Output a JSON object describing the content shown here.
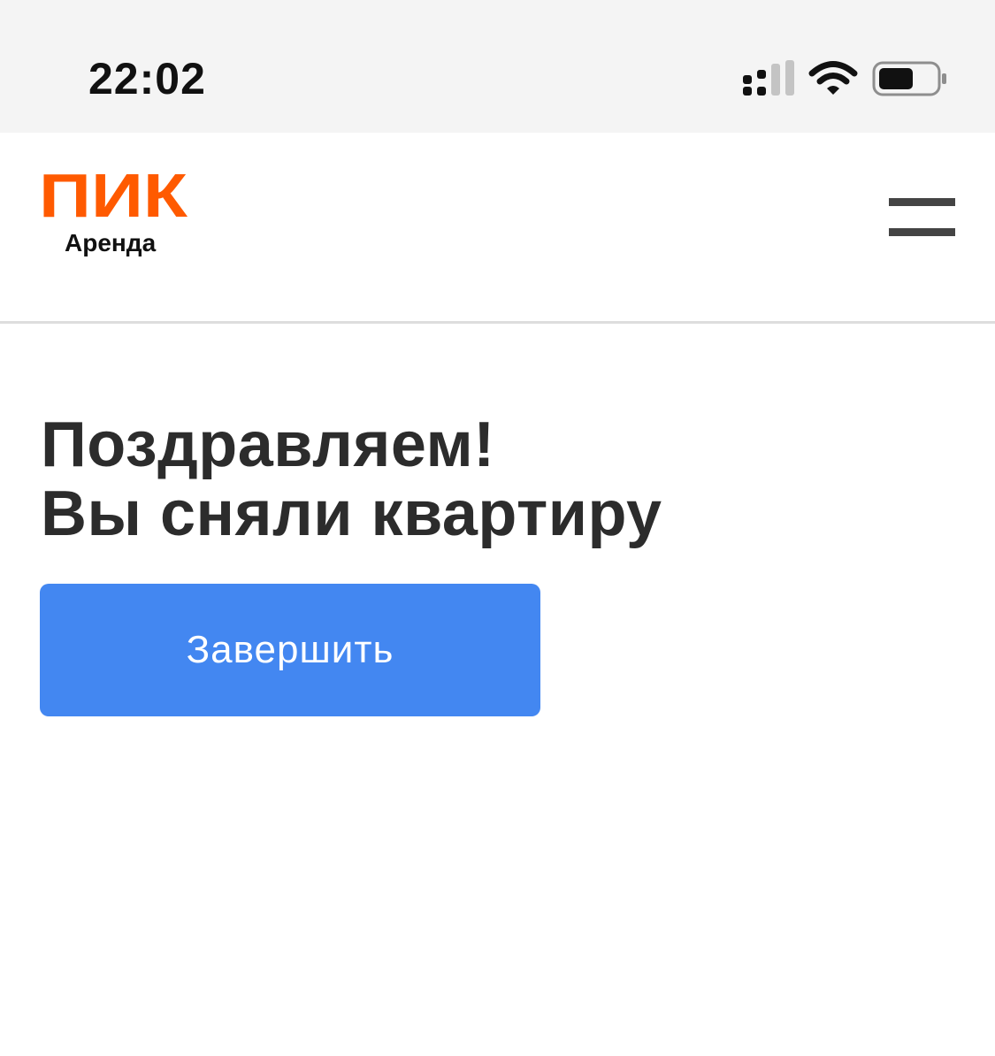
{
  "status_bar": {
    "time": "22:02",
    "icons": [
      "signal-icon",
      "wifi-icon",
      "battery-icon"
    ]
  },
  "header": {
    "logo": {
      "mark": "ПИК",
      "subtitle": "Аренда",
      "mark_color": "#ff5a00"
    },
    "menu_icon": "hamburger-menu-icon"
  },
  "main": {
    "title_line1": "Поздравляем!",
    "title_line2": "Вы сняли квартиру",
    "finish_button_label": "Завершить"
  },
  "colors": {
    "accent": "#4387f1",
    "brand": "#ff5a00",
    "title_text": "#2c2c2c"
  }
}
